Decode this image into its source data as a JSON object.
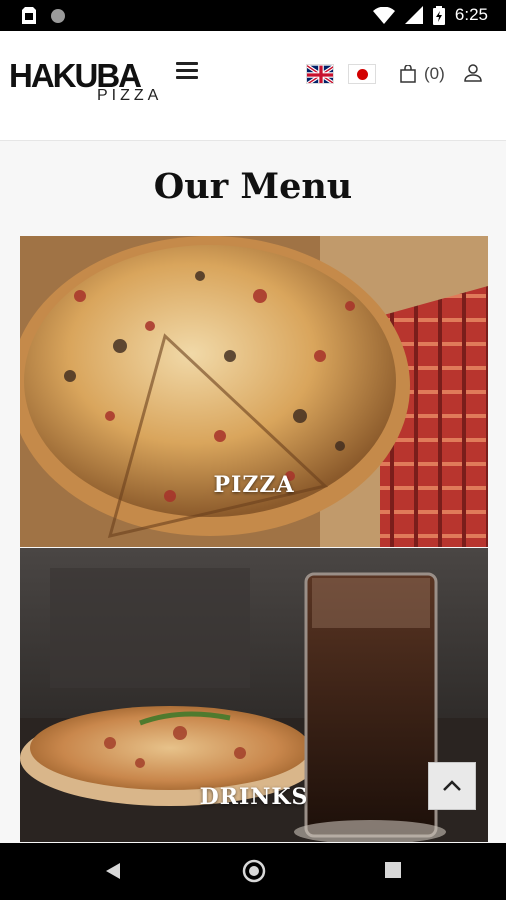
{
  "status_bar": {
    "time": "6:25"
  },
  "header": {
    "logo_main": "HAKUBA",
    "logo_sub": "PIZZA",
    "cart_count": "(0)"
  },
  "main": {
    "title": "Our Menu",
    "categories": [
      {
        "label": "PIZZA"
      },
      {
        "label": "DRINKS"
      }
    ]
  }
}
